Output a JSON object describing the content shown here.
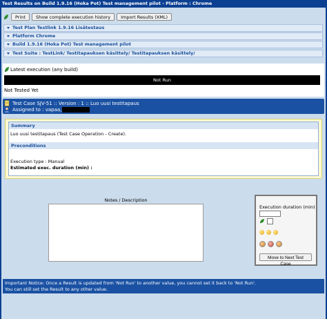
{
  "window": {
    "title": "Test Results on Build 1.9.16 (Hoka Pot) Test management pilot - Platform : Chrome"
  },
  "toolbar": {
    "print_label": "Print",
    "show_history_label": "Show complete execution history",
    "import_label": "Import Results (XML)"
  },
  "sections": [
    "Test Plan Testlink 1.9.16 Lisätestaus",
    "Platform Chrome",
    "Build 1.9.16 (Hoka Pot) Test management pilot",
    "Test Suite : TestLink/ Testitapauksen käsittely/ Testitapauksen käsittely/"
  ],
  "latest_execution": {
    "title": "Latest execution (any build)",
    "status": "Not Run",
    "note": "Not Tested Yet"
  },
  "test_case": {
    "header": "Test Case SJV-51 :: Version : 1 :: Luo uusi testitapaus",
    "assigned_label": "Assigned to : vapaa,"
  },
  "summary": {
    "heading": "Summary",
    "text": "Luo uusi testitapaus (Test Case Operation - Create).",
    "preconditions_heading": "Preconditions",
    "execution_type": "Execution type : Manual",
    "estimated_duration": "Estimated exec. duration (min) :"
  },
  "notes": {
    "label": "Notes / Description",
    "value": ""
  },
  "execution": {
    "duration_label": "Execution duration (min)",
    "duration_value": "",
    "next_button_label": "Move to Next Test Case"
  },
  "notice": {
    "line1": "Important Notice: Once a Result is updated from 'Not Run' to another value, you cannot set it back to 'Not Run'.",
    "line2": "You can still set the Result to any other value."
  },
  "colors": {
    "header_blue": "#1a51a3",
    "title_blue": "#0b3f91",
    "frame_bg": "#cbdcec",
    "panel_yellow": "#fcf9cf"
  }
}
